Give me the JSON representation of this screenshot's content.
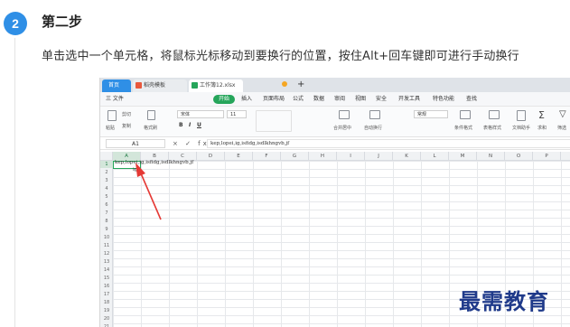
{
  "step": {
    "number": "2",
    "title": "第二步",
    "instruction": "单击选中一个单元格，将鼠标光标移动到要换行的位置，按住Alt+回车键即可进行手动换行"
  },
  "spreadsheet": {
    "tabs": [
      "首页",
      "稻壳模板",
      "工作簿12.xlsx"
    ],
    "menu": [
      "三 文件",
      "开始",
      "插入",
      "页面布局",
      "公式",
      "数据",
      "审阅",
      "视图",
      "安全",
      "开发工具",
      "特色功能",
      "查找"
    ],
    "ribbon": {
      "paste": "粘贴",
      "cut": "剪切",
      "copy": "复制",
      "format_painter": "格式刷",
      "font": "宋体",
      "size": "11",
      "merge": "合并居中",
      "wrap": "自动换行",
      "number_format": "常规",
      "cond_format": "条件格式",
      "table_style": "表格样式",
      "doc_assist": "文档助手",
      "sum": "求和",
      "filter": "筛选"
    },
    "name_box": "A1",
    "formula_tools": "× ✓ fx",
    "formula_value": "kep,lopei,ig,isfidg,isdlkhngvb,jf",
    "columns": [
      "A",
      "B",
      "C",
      "D",
      "E",
      "F",
      "G",
      "H",
      "I",
      "J",
      "K",
      "L",
      "M",
      "N",
      "O",
      "P"
    ],
    "selected_column": "A",
    "rows": [
      "1",
      "2",
      "3",
      "4",
      "5",
      "6",
      "7",
      "8",
      "9",
      "10",
      "11",
      "12",
      "13",
      "14",
      "15",
      "16",
      "17",
      "18",
      "19",
      "20",
      "21"
    ],
    "cell_a1_line1": "kep,lopei,ig,isfidg,isdlkhngvb,jf",
    "cell_a1_line2": "ig"
  },
  "watermark": "最需教育",
  "colors": {
    "accent": "#2f8fe6",
    "wps_green": "#25a55a",
    "arrow": "#e53935",
    "watermark": "#1f3a8a"
  }
}
